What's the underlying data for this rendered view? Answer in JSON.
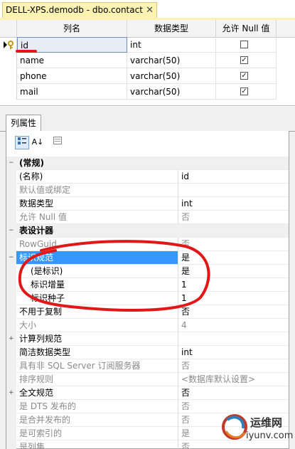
{
  "tab": {
    "title": "DELL-XPS.demodb - dbo.contact",
    "close_glyph": "✕"
  },
  "grid": {
    "headers": [
      "列名",
      "数据类型",
      "允许 Null 值"
    ],
    "rows": [
      {
        "name": "id",
        "type": "int",
        "allow_null": false,
        "key": true,
        "selected": true
      },
      {
        "name": "name",
        "type": "varchar(50)",
        "allow_null": true
      },
      {
        "name": "phone",
        "type": "varchar(50)",
        "allow_null": true
      },
      {
        "name": "mail",
        "type": "varchar(50)",
        "allow_null": true
      }
    ],
    "key_icon": "primary-key-icon",
    "check_glyph": "✓"
  },
  "properties_tab": {
    "label": "列属性"
  },
  "toolbar": {
    "sort_label": "A↓"
  },
  "properties": [
    {
      "kind": "cat",
      "expander": "−",
      "name": "(常规)"
    },
    {
      "kind": "prop",
      "name": "(名称)",
      "value": "id"
    },
    {
      "kind": "prop",
      "disabled": true,
      "name": "默认值或绑定",
      "value": ""
    },
    {
      "kind": "prop",
      "name": "数据类型",
      "value": "int"
    },
    {
      "kind": "prop",
      "disabled": true,
      "name": "允许 Null 值",
      "value": "否"
    },
    {
      "kind": "cat",
      "expander": "−",
      "name": "表设计器"
    },
    {
      "kind": "prop",
      "disabled": true,
      "name": "RowGuid",
      "value": "否"
    },
    {
      "kind": "prop",
      "selected": true,
      "expander": "−",
      "name": "标识规范",
      "value": "是"
    },
    {
      "kind": "prop",
      "indent": true,
      "name": "(是标识)",
      "value": "是"
    },
    {
      "kind": "prop",
      "indent": true,
      "name": "标识增量",
      "value": "1"
    },
    {
      "kind": "prop",
      "indent": true,
      "name": "标识种子",
      "value": "1"
    },
    {
      "kind": "prop",
      "name": "不用于复制",
      "value": "否"
    },
    {
      "kind": "prop",
      "disabled": true,
      "name": "大小",
      "value": "4"
    },
    {
      "kind": "prop",
      "expander": "+",
      "name": "计算列规范",
      "value": ""
    },
    {
      "kind": "prop",
      "name": "简洁数据类型",
      "value": "int"
    },
    {
      "kind": "prop",
      "disabled": true,
      "name": "具有非 SQL Server 订阅服务器",
      "value": "否"
    },
    {
      "kind": "prop",
      "disabled": true,
      "name": "排序规则",
      "value": "<数据库默认设置>"
    },
    {
      "kind": "prop",
      "expander": "+",
      "name": "全文规范",
      "value": "否"
    },
    {
      "kind": "prop",
      "disabled": true,
      "name": "是 DTS 发布的",
      "value": "否"
    },
    {
      "kind": "prop",
      "disabled": true,
      "name": "是合并发布的",
      "value": "否"
    },
    {
      "kind": "prop",
      "disabled": true,
      "name": "是可索引的",
      "value": "是"
    },
    {
      "kind": "prop",
      "disabled": true,
      "name": "是列集",
      "value": "否"
    }
  ],
  "watermark": {
    "line1": "运维网",
    "line2": "iyunv.com"
  },
  "colors": {
    "annotation": "#e21717",
    "selection": "#3399ff",
    "tab": "#fcf3b3"
  }
}
